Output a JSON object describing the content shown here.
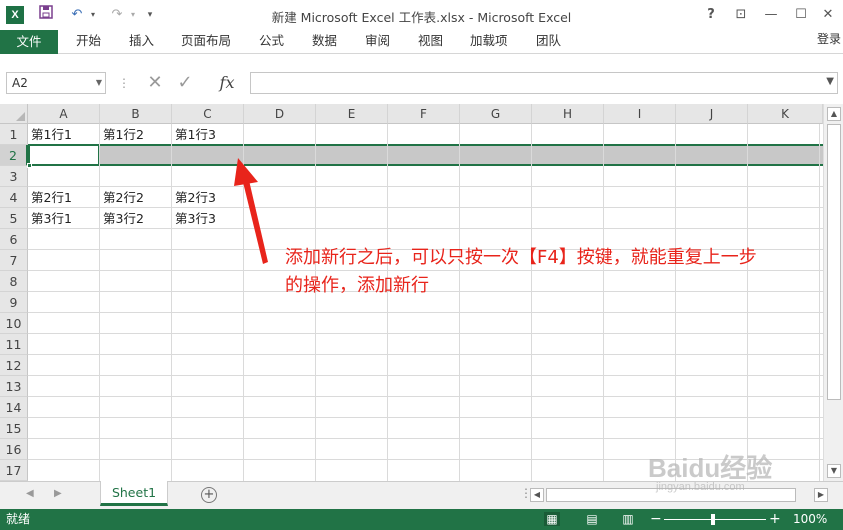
{
  "app": {
    "title": "新建 Microsoft Excel 工作表.xlsx - Microsoft Excel",
    "logo": "X",
    "accent_color": "#217346"
  },
  "qat": {
    "save_icon": "save-icon",
    "undo_icon": "undo-icon",
    "redo_icon": "redo-icon",
    "customize_icon": "customize-qat-icon"
  },
  "window": {
    "help": "?",
    "ribbon_display": "⊡",
    "minimize": "—",
    "restore": "☐",
    "close": "✕"
  },
  "ribbon": {
    "file": "文件",
    "tabs": [
      "开始",
      "插入",
      "页面布局",
      "公式",
      "数据",
      "审阅",
      "视图",
      "加载项",
      "团队"
    ],
    "login": "登录"
  },
  "formula_bar": {
    "name_box": "A2",
    "cancel_icon": "✕",
    "enter_icon": "✓",
    "fx": "fx",
    "content": ""
  },
  "grid": {
    "columns": [
      "A",
      "B",
      "C",
      "D",
      "E",
      "F",
      "G",
      "H",
      "I",
      "J",
      "K"
    ],
    "rows": [
      "1",
      "2",
      "3",
      "4",
      "5",
      "6",
      "7",
      "8",
      "9",
      "10",
      "11",
      "12",
      "13",
      "14",
      "15",
      "16",
      "17"
    ],
    "selected_row": "2",
    "active_cell": "A2",
    "cells": [
      [
        "第1行1",
        "第1行2",
        "第1行3"
      ],
      [
        "",
        "",
        ""
      ],
      [
        "",
        "",
        ""
      ],
      [
        "第2行1",
        "第2行2",
        "第2行3"
      ],
      [
        "第3行1",
        "第3行2",
        "第3行3"
      ]
    ]
  },
  "annotation": {
    "line1": "添加新行之后，可以只按一次【F4】按键，就能重复上一步",
    "line2": "的操作，添加新行",
    "color": "#e8241b"
  },
  "sheets": {
    "tabs": [
      "Sheet1"
    ],
    "active": "Sheet1",
    "add_label": "+"
  },
  "status": {
    "text": "就绪",
    "zoom_minus": "−",
    "zoom_plus": "+",
    "zoom_level": "100%"
  },
  "watermark": {
    "brand": "Baidu经验",
    "url": "jingyan.baidu.com"
  }
}
